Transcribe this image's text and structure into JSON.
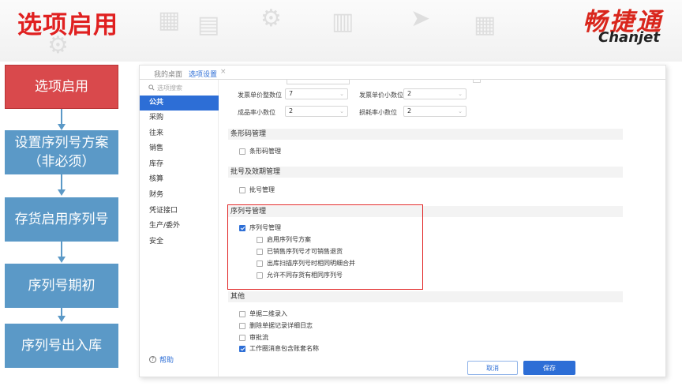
{
  "slide": {
    "title": "选项启用",
    "brand_cn": "畅捷通",
    "brand_en": "Chanjet",
    "accent_color": "#e02020",
    "step_color": "#5b99c7"
  },
  "flow_steps": [
    {
      "label": "选项启用"
    },
    {
      "label": "设置序列号方案（非必须）"
    },
    {
      "label": "存货启用序列号"
    },
    {
      "label": "序列号期初"
    },
    {
      "label": "序列号出入库"
    }
  ],
  "tabs": [
    {
      "label": "我的桌面"
    },
    {
      "label": "选项设置"
    }
  ],
  "tab_close": "×",
  "sidebar": {
    "search_placeholder": "选项搜索",
    "search_icon": "search-icon",
    "items": [
      {
        "label": "公共"
      },
      {
        "label": "采购"
      },
      {
        "label": "往来"
      },
      {
        "label": "销售"
      },
      {
        "label": "库存"
      },
      {
        "label": "核算"
      },
      {
        "label": "财务"
      },
      {
        "label": "凭证接口"
      },
      {
        "label": "生产/委外"
      },
      {
        "label": "安全"
      }
    ],
    "help_label": "帮助",
    "help_icon": "question-circle-icon"
  },
  "fields": {
    "invoice_unit_price_int": {
      "label": "发票单价整数位",
      "value": "7"
    },
    "invoice_unit_price_dec": {
      "label": "发票单价小数位",
      "value": "2"
    },
    "finished_rate_dec": {
      "label": "成品率小数位",
      "value": "2"
    },
    "loss_rate_dec": {
      "label": "损耗率小数位",
      "value": "2"
    }
  },
  "sections": {
    "barcode": {
      "title": "条形码管理",
      "items": [
        {
          "label": "条形码管理"
        }
      ]
    },
    "batch": {
      "title": "批号及效期管理",
      "items": [
        {
          "label": "批号管理"
        }
      ]
    },
    "serial": {
      "title": "序列号管理",
      "main": {
        "label": "序列号管理"
      },
      "subs": [
        {
          "label": "启用序列号方案"
        },
        {
          "label": "已销售序列号才可销售退货"
        },
        {
          "label": "出库扫描序列号时相同明细合并"
        },
        {
          "label": "允许不同存货有相同序列号"
        }
      ]
    },
    "other": {
      "title": "其他",
      "items": [
        {
          "label": "单据二维录入"
        },
        {
          "label": "删除单据记录详细日志"
        },
        {
          "label": "审批流"
        },
        {
          "label": "工作圈消息包含账套名称"
        }
      ]
    }
  },
  "buttons": {
    "cancel": "取消",
    "save": "保存"
  },
  "app_accent": "#2d6ed6"
}
